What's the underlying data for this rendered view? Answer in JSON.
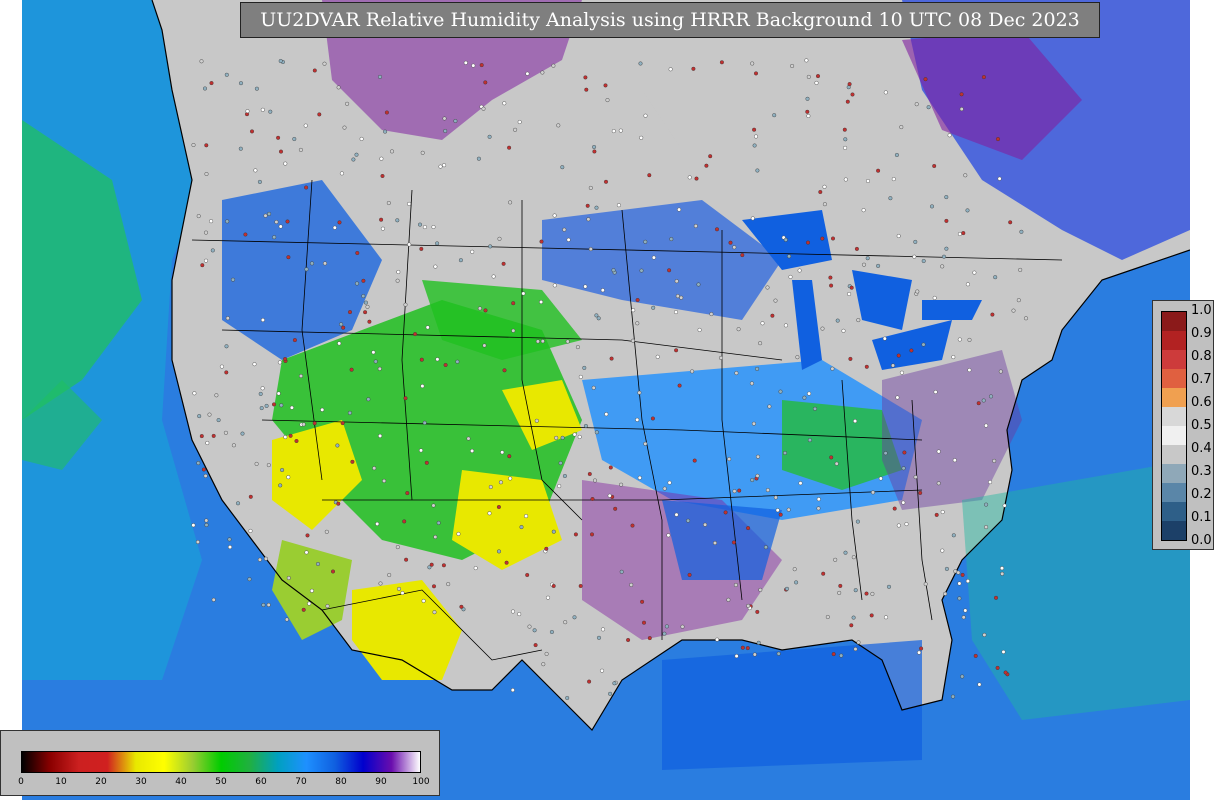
{
  "title": "UU2DVAR Relative Humidity Analysis using HRRR Background 10 UTC 08 Dec 2023",
  "map": {
    "ocean_color": "#2a7de0",
    "land_color": "#c8c8c8",
    "border_color": "#000000",
    "dry_color": "#e8e800",
    "mid_color": "#20c020",
    "moist_color": "#1060e0",
    "sat_color": "#8020a0"
  },
  "legend_right": {
    "ticks": [
      "1.0",
      "0.9",
      "0.8",
      "0.7",
      "0.6",
      "0.5",
      "0.4",
      "0.3",
      "0.2",
      "0.1",
      "0.0"
    ],
    "colors": [
      "#8b1a1a",
      "#b22222",
      "#cd3b3b",
      "#e06040",
      "#f0a050",
      "#d8d8d8",
      "#f0f0f0",
      "#c8c8c8",
      "#8fa8b8",
      "#5a86a8",
      "#2e5f88",
      "#1c4068"
    ]
  },
  "legend_bottom": {
    "ticks": [
      "0",
      "10",
      "20",
      "30",
      "40",
      "50",
      "60",
      "70",
      "80",
      "90",
      "100"
    ],
    "stops": [
      "#000000",
      "#8b0000",
      "#cc2020",
      "#d02020",
      "#e8e800",
      "#ffff00",
      "#9acd32",
      "#00cc00",
      "#20b040",
      "#00a0c0",
      "#1e90ff",
      "#1060e0",
      "#0000cd",
      "#6a0dad",
      "#ffffff"
    ]
  }
}
